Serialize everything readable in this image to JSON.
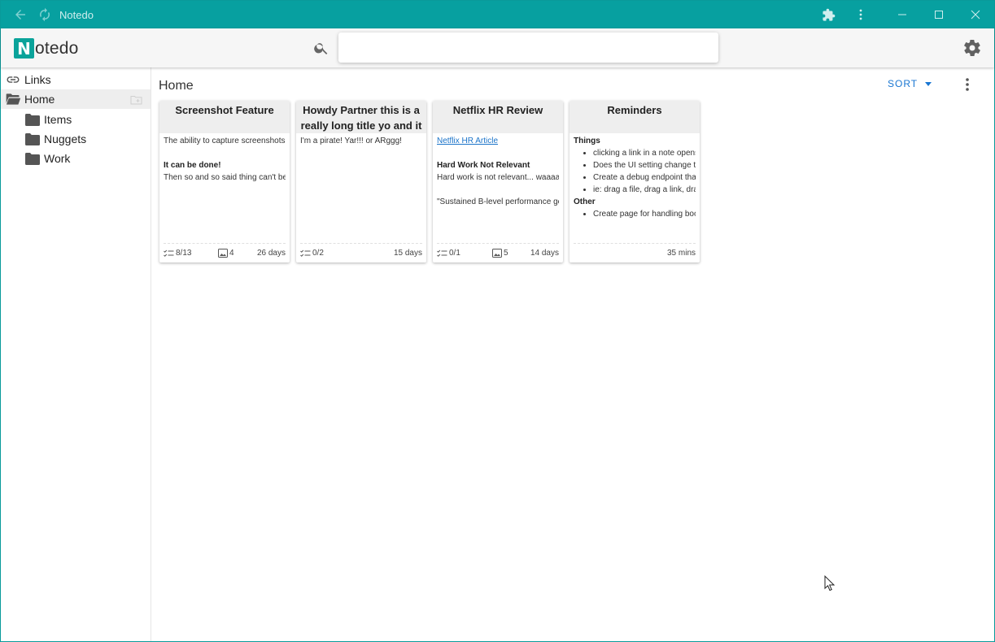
{
  "window": {
    "title": "Notedo"
  },
  "header": {
    "logo_letter": "N",
    "logo_text": "otedo",
    "search": {
      "value": "",
      "placeholder": ""
    }
  },
  "sidebar": {
    "items": [
      {
        "label": "Links",
        "icon": "link-icon"
      },
      {
        "label": "Home",
        "icon": "folder-open-icon",
        "active": true
      },
      {
        "label": "Items",
        "icon": "folder-icon"
      },
      {
        "label": "Nuggets",
        "icon": "folder-icon"
      },
      {
        "label": "Work",
        "icon": "folder-icon"
      }
    ]
  },
  "main": {
    "title": "Home",
    "sort_label": "SORT"
  },
  "cards": [
    {
      "title": "Screenshot Feature",
      "lines": [
        "The ability to capture screenshots",
        "",
        "It can be done!",
        "Then so and so said thing can't be"
      ],
      "checklist": "8/13",
      "images": "4",
      "age": "26 days"
    },
    {
      "title": "Howdy Partner this is a really long title yo and it",
      "lines": [
        "I'm a pirate! Yar!!! or ARggg!"
      ],
      "checklist": "0/2",
      "age": "15 days"
    },
    {
      "title": "Netflix HR Review",
      "link": "Netflix HR Article",
      "lines": [
        "",
        "Hard Work Not Relevant",
        "Hard work is not relevant... waaaa",
        "",
        "\"Sustained B-level performance ge"
      ],
      "checklist": "0/1",
      "images": "5",
      "age": "14 days"
    },
    {
      "title": "Reminders",
      "section1": "Things",
      "bullets1": [
        "clicking a link in a note opens",
        "Does the UI setting change th",
        "Create a debug endpoint that",
        "ie: drag a file, drag a link, drag"
      ],
      "section2": "Other",
      "bullets2": [
        "Create page for handling boo"
      ],
      "age": "35 mins"
    }
  ],
  "colors": {
    "titlebar": "#07a0a0",
    "brand": "#0aa39a",
    "accent": "#1976d2"
  }
}
